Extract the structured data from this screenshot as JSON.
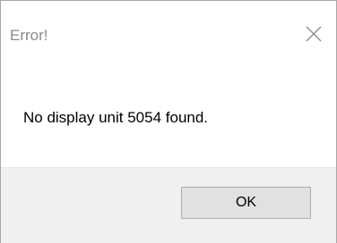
{
  "dialog": {
    "title": "Error!",
    "close_icon": "close-icon",
    "message": "No display unit 5054 found.",
    "ok_label": "OK"
  },
  "colors": {
    "title_text": "#8a8a8a",
    "footer_bg": "#f0f0f0",
    "button_bg": "#e1e1e1",
    "button_border": "#adadad"
  }
}
